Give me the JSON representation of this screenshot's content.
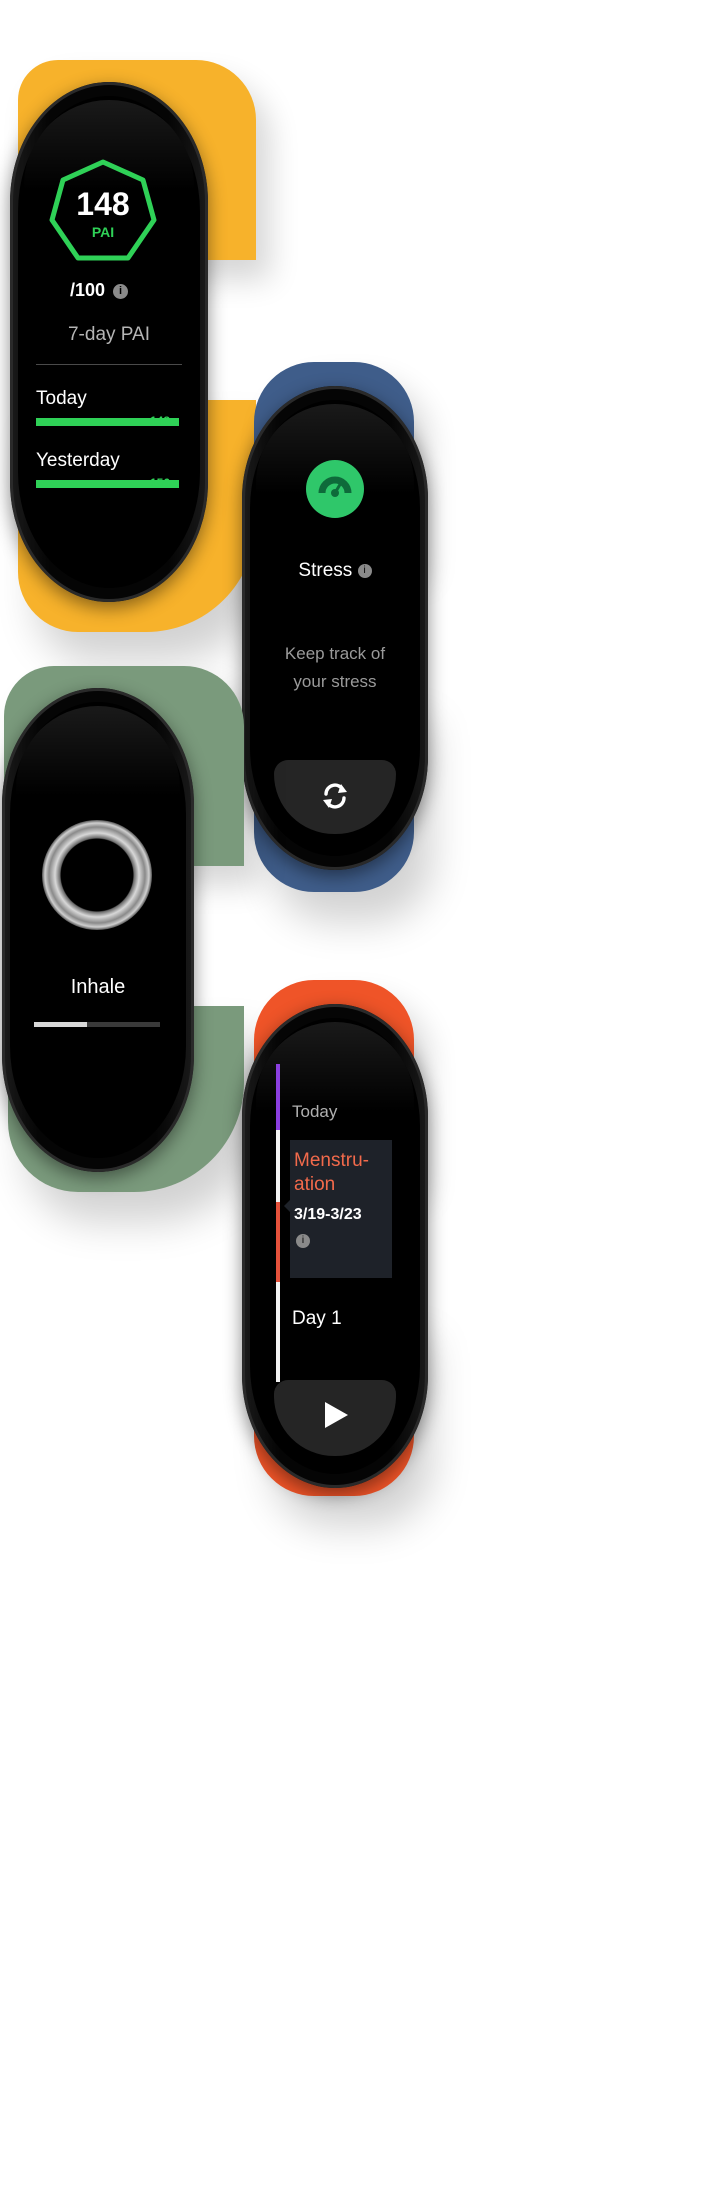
{
  "colors": {
    "band_yellow": "#f7b22b",
    "band_blue": "#3f5d8a",
    "band_green": "#7a9a7c",
    "band_orange": "#ef5428",
    "pai_green": "#2fd157",
    "stress_green": "#2fc76a",
    "menstruation_orange": "#f26a4b",
    "cycle_purple": "#8b3fe0",
    "cycle_red": "#e5513b"
  },
  "pai": {
    "score": "148",
    "unit": "PAI",
    "goal": "/100",
    "title": "7-day PAI",
    "today_label": "Today",
    "today_value": "148",
    "today_level": 0.93,
    "yesterday_label": "Yesterday",
    "yesterday_value": "156",
    "yesterday_level": 0.93
  },
  "stress": {
    "title": "Stress",
    "line1": "Keep track of",
    "line2": "your stress"
  },
  "breathing": {
    "label": "Inhale",
    "progress": 0.42
  },
  "cycle": {
    "today_label": "Today",
    "phase_line1": "Menstru-",
    "phase_line2": "ation",
    "date_range": "3/19-3/23",
    "day_label": "Day 1"
  }
}
